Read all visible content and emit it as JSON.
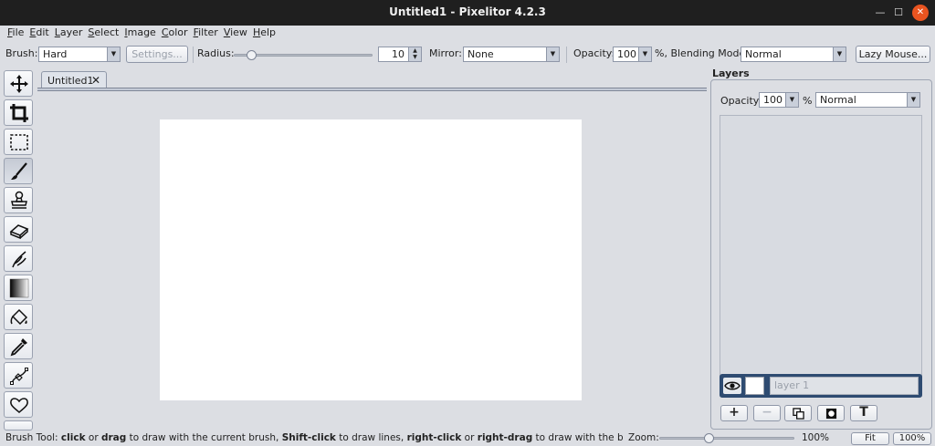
{
  "window": {
    "title": "Untitled1 - Pixelitor 4.2.3"
  },
  "menu": [
    "File",
    "Edit",
    "Layer",
    "Select",
    "Image",
    "Color",
    "Filter",
    "View",
    "Help"
  ],
  "toolbar": {
    "brush_label": "Brush:",
    "brush_value": "Hard",
    "settings_label": "Settings...",
    "radius_label": "Radius:",
    "radius_value": "10",
    "mirror_label": "Mirror:",
    "mirror_value": "None",
    "opacity_label": "Opacity:",
    "opacity_value": "100",
    "blending_label": "%, Blending Mode:",
    "blending_value": "Normal",
    "lazy_mouse_label": "Lazy Mouse..."
  },
  "tools": [
    {
      "name": "move-icon",
      "active": false
    },
    {
      "name": "crop-icon",
      "active": false
    },
    {
      "name": "selection-icon",
      "active": false
    },
    {
      "name": "brush-icon",
      "active": true
    },
    {
      "name": "clone-stamp-icon",
      "active": false
    },
    {
      "name": "eraser-icon",
      "active": false
    },
    {
      "name": "smudge-icon",
      "active": false
    },
    {
      "name": "gradient-icon",
      "active": false
    },
    {
      "name": "paint-bucket-icon",
      "active": false
    },
    {
      "name": "color-picker-icon",
      "active": false
    },
    {
      "name": "pen-icon",
      "active": false
    },
    {
      "name": "shapes-icon",
      "active": false
    }
  ],
  "document_tab": {
    "label": "Untitled1",
    "close": "✕"
  },
  "layers": {
    "title": "Layers",
    "opacity_label": "Opacity:",
    "opacity_value": "100",
    "percent": "%",
    "blend_value": "Normal",
    "layer_name": "layer 1"
  },
  "status": {
    "prefix": "Brush Tool: ",
    "b1": "click",
    "t1": " or ",
    "b2": "drag",
    "t2": " to draw with the current brush, ",
    "b3": "Shift-click",
    "t3": " to draw lines, ",
    "b4": "right-click",
    "t4": " or ",
    "b5": "right-drag",
    "t5": " to draw with the background c",
    "zoom_label": "Zoom:",
    "zoom_value": "100%",
    "fit_label": "Fit",
    "hundred_label": "100%"
  }
}
